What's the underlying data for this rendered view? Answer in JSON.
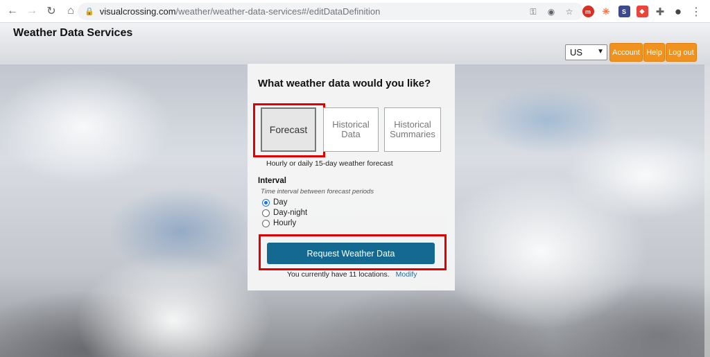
{
  "browser": {
    "url_domain": "visualcrossing.com",
    "url_path": "/weather/weather-data-services#/editDataDefinition",
    "nav_icons": [
      "back-arrow-icon",
      "forward-arrow-icon",
      "reload-icon",
      "home-icon"
    ],
    "lock_icon": "lock-icon",
    "toolbar_icons": [
      "key-icon",
      "eye-off-icon",
      "star-icon"
    ],
    "extensions": [
      {
        "name": "extension-red-icon",
        "color": "#d93025",
        "glyph": "m"
      },
      {
        "name": "extension-orange-icon",
        "color": "#ff7043",
        "glyph": "✳"
      },
      {
        "name": "extension-dark-icon",
        "color": "#3c4a8c",
        "glyph": "S"
      },
      {
        "name": "extension-shield-icon",
        "color": "#e8453c",
        "glyph": "◆"
      },
      {
        "name": "puzzle-icon",
        "color": "#5f6368",
        "glyph": "✚"
      },
      {
        "name": "profile-icon",
        "color": "#5f6368",
        "glyph": "●"
      },
      {
        "name": "menu-dots-icon",
        "color": "#5f6368",
        "glyph": "⋮"
      }
    ]
  },
  "header": {
    "title": "Weather Data Services",
    "language": "US",
    "buttons": {
      "account": "Account",
      "help": "Help",
      "logout": "Log out"
    },
    "accent_color": "#f0921f"
  },
  "panel": {
    "title": "What weather data would you like?",
    "types": [
      {
        "label": "Forecast",
        "selected": true
      },
      {
        "label": "Historical Data",
        "selected": false
      },
      {
        "label": "Historical Summaries",
        "selected": false
      }
    ],
    "type_description": "Hourly or daily 15-day weather forecast",
    "interval": {
      "label": "Interval",
      "hint": "Time interval between forecast periods",
      "options": [
        {
          "label": "Day",
          "checked": true
        },
        {
          "label": "Day-night",
          "checked": false
        },
        {
          "label": "Hourly",
          "checked": false
        }
      ]
    },
    "request_button": "Request Weather Data",
    "locations_note": "You currently have 11 locations.",
    "modify_link": "Modify",
    "button_color": "#13698f",
    "highlight_color": "#e00000"
  }
}
